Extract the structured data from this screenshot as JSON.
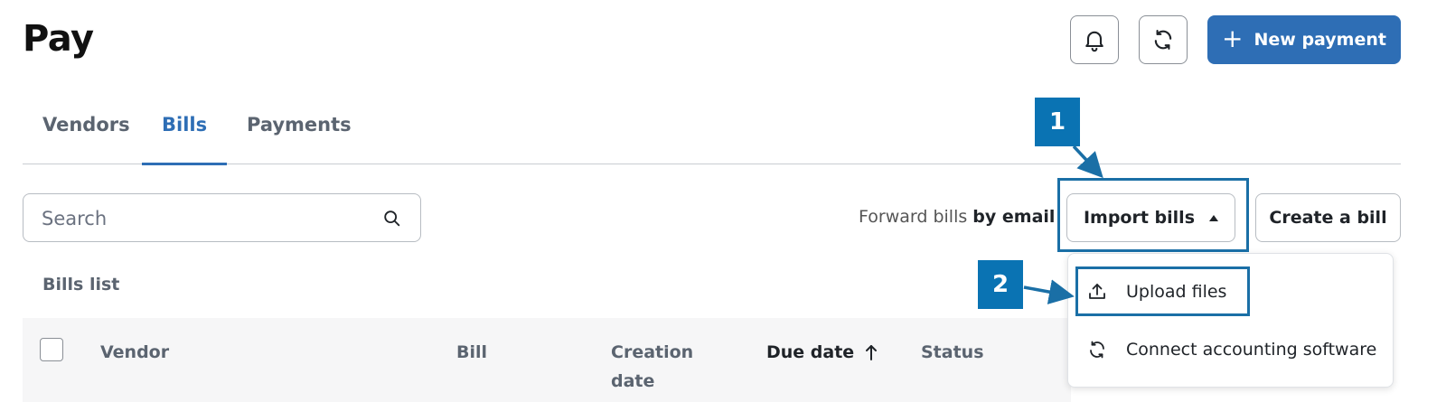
{
  "header": {
    "title": "Pay",
    "new_payment_label": "New payment"
  },
  "tabs": [
    {
      "label": "Vendors"
    },
    {
      "label": "Bills"
    },
    {
      "label": "Payments"
    }
  ],
  "toolbar": {
    "search_placeholder": "Search",
    "forward_text": "Forward bills",
    "forward_link": "by email",
    "import_label": "Import bills",
    "create_label": "Create a bill"
  },
  "bills_list_label": "Bills list",
  "table": {
    "columns": [
      "Vendor",
      "Bill",
      "Creation date",
      "Due date",
      "Status"
    ]
  },
  "dropdown": {
    "items": [
      {
        "label": "Upload files",
        "icon": "upload-icon"
      },
      {
        "label": "Connect accounting software",
        "icon": "sync-icon"
      }
    ]
  },
  "annotations": {
    "step1": "1",
    "step2": "2"
  },
  "colors": {
    "accent": "#2e6eb5",
    "annotation": "#0a73b3"
  }
}
